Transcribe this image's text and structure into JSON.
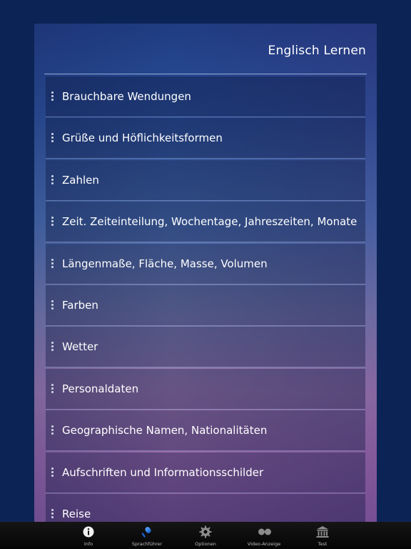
{
  "header": {
    "title": "Englisch Lernen"
  },
  "list": {
    "items": [
      {
        "label": "Brauchbare Wendungen"
      },
      {
        "label": "Grüße und Höflichkeitsformen"
      },
      {
        "label": "Zahlen"
      },
      {
        "label": "Zeit. Zeiteinteilung, Wochentage, Jahreszeiten, Monate"
      },
      {
        "label": "Längenmaße, Fläche, Masse, Volumen"
      },
      {
        "label": "Farben"
      },
      {
        "label": "Wetter"
      },
      {
        "label": "Personaldaten"
      },
      {
        "label": "Geographische Namen, Nationalitäten"
      },
      {
        "label": "Aufschriften und Informationsschilder"
      },
      {
        "label": "Reise"
      }
    ]
  },
  "tabbar": {
    "tabs": [
      {
        "label": "Info",
        "icon": "info-icon"
      },
      {
        "label": "Sprachführer",
        "icon": "microphone-icon"
      },
      {
        "label": "Optionen",
        "icon": "gear-icon"
      },
      {
        "label": "Video-Anzeige",
        "icon": "video-icon"
      },
      {
        "label": "Test",
        "icon": "bank-icon"
      }
    ]
  },
  "colors": {
    "background": "#0c2455",
    "panel_top": "#1f3c82",
    "panel_bottom": "#8a5aa0",
    "tabbar": "#0a0a0a",
    "text": "#ffffff",
    "accent_blue": "#1f6fd6"
  }
}
